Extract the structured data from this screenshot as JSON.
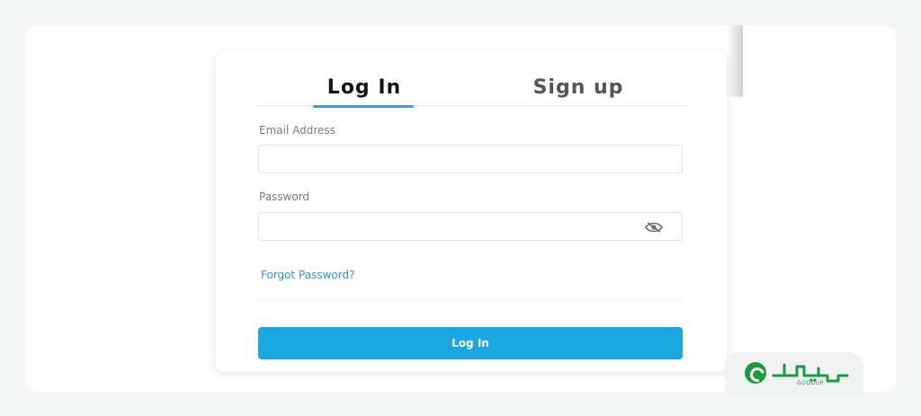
{
  "tabs": {
    "login_label": "Log In",
    "signup_label": "Sign up"
  },
  "form": {
    "email_label": "Email Address",
    "email_value": "",
    "password_label": "Password",
    "password_value": "",
    "forgot_label": "Forgot Password?",
    "submit_label": "Log In"
  },
  "icons": {
    "password_toggle": "eye-slash-icon",
    "brand": "brand-logo"
  },
  "brand": {
    "subtext": "GOODUP"
  },
  "colors": {
    "accent": "#1aa6e0",
    "tab_underline": "#2aa8d8",
    "brand_green": "#1d9a42"
  }
}
